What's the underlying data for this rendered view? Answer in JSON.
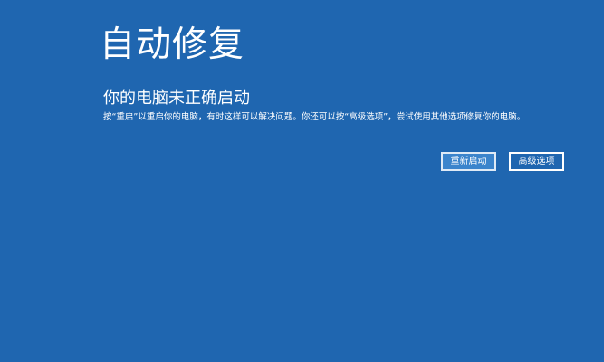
{
  "screen": {
    "title": "自动修复",
    "subtitle": "你的电脑未正确启动",
    "description": "按“重启”以重启你的电脑，有时这样可以解决问题。你还可以按“高级选项”，尝试使用其他选项修复你的电脑。"
  },
  "buttons": {
    "restart": "重新启动",
    "advanced": "高级选项"
  },
  "colors": {
    "background": "#1f66b0",
    "primary_button": "#3b84cc",
    "text": "#ffffff"
  }
}
